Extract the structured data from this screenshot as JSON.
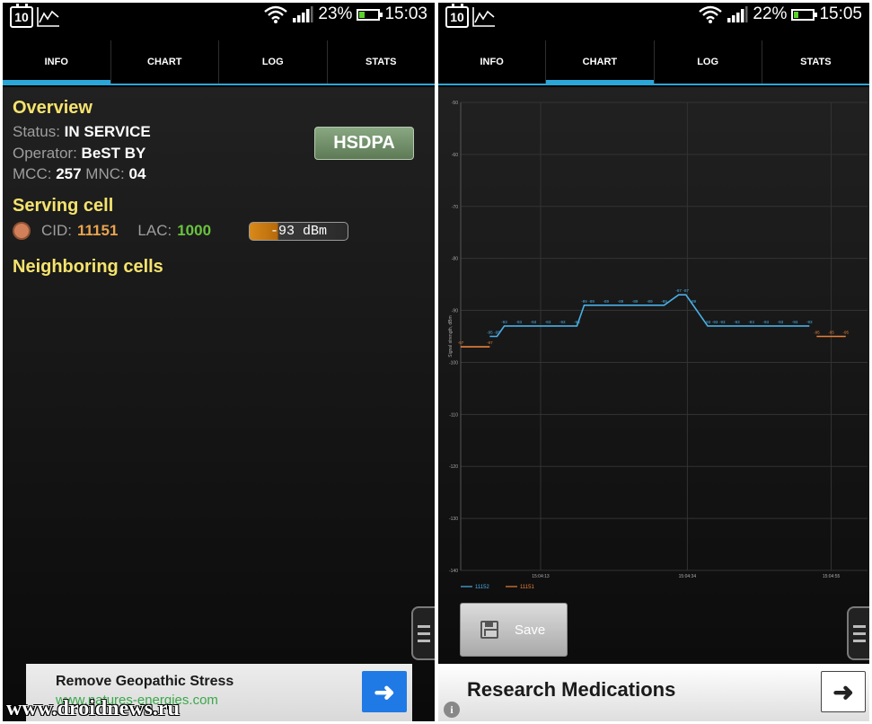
{
  "left": {
    "status_bar": {
      "calendar": "10",
      "battery": "23%",
      "battery_level": 0.23,
      "time": "15:03"
    },
    "tabs": [
      {
        "label": "INFO",
        "active": true
      },
      {
        "label": "CHART",
        "active": false
      },
      {
        "label": "LOG",
        "active": false
      },
      {
        "label": "STATS",
        "active": false
      }
    ],
    "overview": {
      "title": "Overview",
      "status_label": "Status:",
      "status_value": "IN SERVICE",
      "operator_label": "Operator:",
      "operator_value": "BeST BY",
      "mcc_label": "MCC:",
      "mcc_value": "257",
      "mnc_label": "MNC:",
      "mnc_value": "04",
      "network_type": "HSDPA"
    },
    "serving_cell": {
      "title": "Serving cell",
      "cid_label": "CID:",
      "cid_value": "11151",
      "lac_label": "LAC:",
      "lac_value": "1000",
      "signal": "-93 dBm"
    },
    "neighboring": {
      "title": "Neighboring cells"
    },
    "ad": {
      "title": "Remove Geopathic Stress",
      "url": "www.natures-energies.com"
    },
    "watermark": "www.droidnews.ru"
  },
  "right": {
    "status_bar": {
      "calendar": "10",
      "battery": "22%",
      "battery_level": 0.22,
      "time": "15:05"
    },
    "tabs": [
      {
        "label": "INFO",
        "active": false
      },
      {
        "label": "CHART",
        "active": true
      },
      {
        "label": "LOG",
        "active": false
      },
      {
        "label": "STATS",
        "active": false
      }
    ],
    "save_label": "Save",
    "ad": {
      "title": "Research Medications"
    }
  },
  "colors": {
    "accent": "#2aa7d8",
    "title_yellow": "#f5e36d",
    "cid_orange": "#e8a34e",
    "lac_green": "#69c33f",
    "series_blue": "#4ab0e6",
    "series_orange": "#e8803a"
  },
  "icons": [
    "calendar-icon",
    "chart-icon",
    "wifi-icon",
    "signal-icon",
    "battery-icon",
    "save-icon",
    "arrow-right-icon",
    "menu-handle-icon",
    "info-icon"
  ],
  "chart_data": {
    "type": "line",
    "ylabel": "Signal strength, dBm",
    "ylim": [
      -140,
      -50
    ],
    "yticks": [
      "-50",
      "-60",
      "-70",
      "-80",
      "-90",
      "-100",
      "-110",
      "-120",
      "-130",
      "-140"
    ],
    "xticks": [
      "15:04:13",
      "15:04:34",
      "15:04:55"
    ],
    "grid": true,
    "legend": "bottom-left",
    "series": [
      {
        "name": "11151",
        "segments": [
          {
            "x": [
              0,
              2
            ],
            "y": [
              -97,
              -97
            ],
            "labels": [
              "-97",
              "-97"
            ]
          },
          {
            "x": [
              24.5,
              26.5
            ],
            "y": [
              -95,
              -95
            ],
            "labels": [
              "-95",
              "-95",
              "-95"
            ]
          }
        ]
      },
      {
        "name": "11152",
        "segments": [
          {
            "x": [
              2,
              2.5,
              3,
              4,
              5,
              6,
              7,
              8,
              8.5,
              9,
              10,
              11,
              12,
              13,
              14,
              15,
              15.5,
              16,
              17,
              17.5,
              18,
              19,
              20,
              21,
              22,
              23,
              24
            ],
            "y": [
              -95,
              -95,
              -93,
              -93,
              -93,
              -93,
              -93,
              -93,
              -89,
              -89,
              -89,
              -89,
              -89,
              -89,
              -89,
              -87,
              -87,
              -89,
              -93,
              -93,
              -93,
              -93,
              -93,
              -93,
              -93,
              -93,
              -93
            ],
            "labels": [
              "-95",
              "-95",
              "-93",
              "-93",
              "-93",
              "-93",
              "-93",
              "-93",
              "-89",
              "-89",
              "-89",
              "-89",
              "-89",
              "-89",
              "-89",
              "-87",
              "-87",
              "-89",
              "-93",
              "-93",
              "-93",
              "-93",
              "-93",
              "-93",
              "-93",
              "-93",
              "-93"
            ]
          }
        ]
      }
    ]
  }
}
